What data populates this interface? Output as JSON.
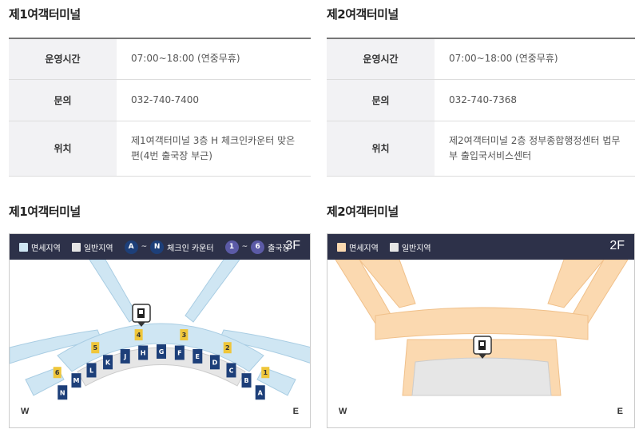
{
  "terminal1": {
    "title": "제1여객터미널",
    "rows": [
      {
        "label": "운영시간",
        "value": "07:00~18:00 (연중무휴)"
      },
      {
        "label": "문의",
        "value": "032-740-7400"
      },
      {
        "label": "위치",
        "value": "제1여객터미널 3층 H 체크인카운터 맞은 편(4번 출국장 부근)"
      }
    ],
    "map_title": "제1여객터미널",
    "map": {
      "legend_duty_free": "면세지역",
      "legend_general": "일반지역",
      "checkin_from": "A",
      "checkin_to": "N",
      "checkin_label": "체크인 카운터",
      "gate_from": "1",
      "gate_to": "6",
      "gate_label": "출국장",
      "floor": "3F",
      "west": "W",
      "east": "E",
      "counters": [
        "N",
        "M",
        "L",
        "K",
        "J",
        "H",
        "G",
        "F",
        "E",
        "D",
        "C",
        "B",
        "A"
      ],
      "exits": [
        "6",
        "5",
        "4",
        "3",
        "2",
        "1"
      ]
    }
  },
  "terminal2": {
    "title": "제2여객터미널",
    "rows": [
      {
        "label": "운영시간",
        "value": "07:00~18:00 (연중무휴)"
      },
      {
        "label": "문의",
        "value": "032-740-7368"
      },
      {
        "label": "위치",
        "value": "제2여객터미널 2층 정부종합행정센터 법무부 출입국서비스센터"
      }
    ],
    "map_title": "제2여객터미널",
    "map": {
      "legend_duty_free": "면세지역",
      "legend_general": "일반지역",
      "floor": "2F",
      "west": "W",
      "east": "E"
    }
  },
  "colors": {
    "header_bg": "#2d3149",
    "duty_free_t1": "#cfe6f3",
    "duty_free_t2": "#fbd9b0",
    "general": "#e6e6e6",
    "counter": "#1d3f79",
    "gate": "#efc63a",
    "circle": "#5b5aa6"
  }
}
